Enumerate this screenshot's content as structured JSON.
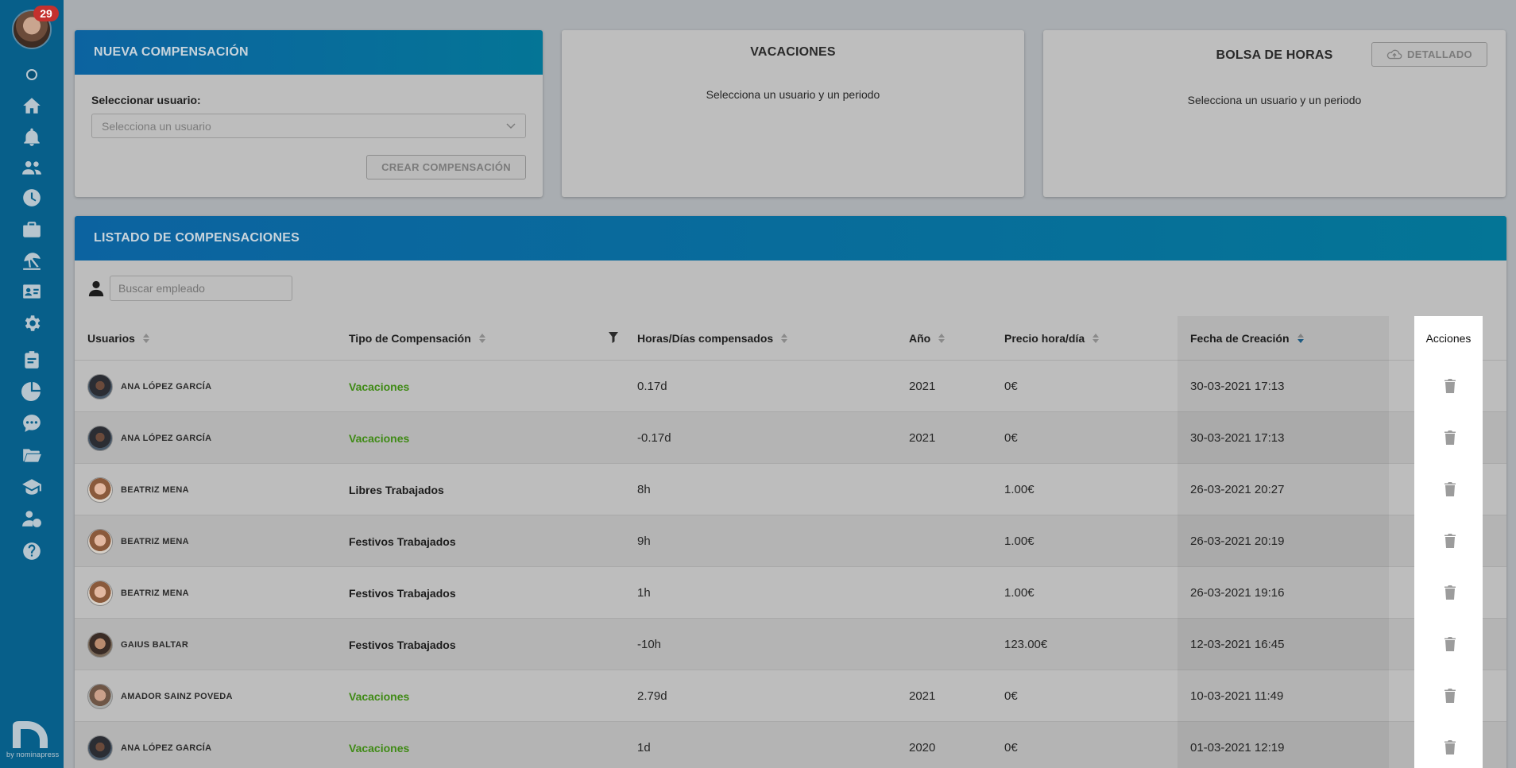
{
  "sidebar": {
    "notification_count": "29",
    "brand_caption": "by nominapress",
    "icons": [
      "home-icon",
      "bell-icon",
      "users-icon",
      "clock-icon",
      "briefcase-icon",
      "beach-icon",
      "id-card-icon",
      "gear-icon",
      "clipboard-icon",
      "pie-chart-icon",
      "chat-icon",
      "folder-icon",
      "graduation-icon",
      "user-money-icon",
      "help-icon"
    ]
  },
  "nueva": {
    "header": "NUEVA COMPENSACIÓN",
    "select_label": "Seleccionar usuario:",
    "select_placeholder": "Selecciona un usuario",
    "create_button": "CREAR COMPENSACIÓN"
  },
  "vacaciones": {
    "title": "VACACIONES",
    "message": "Selecciona un usuario y un periodo"
  },
  "bolsa": {
    "title": "BOLSA DE HORAS",
    "detail_button": "DETALLADO",
    "message": "Selecciona un usuario y un periodo"
  },
  "listado": {
    "header": "LISTADO DE COMPENSACIONES",
    "search_placeholder": "Buscar empleado",
    "columns": {
      "usuarios": "Usuarios",
      "tipo": "Tipo de Compensación",
      "horas": "Horas/Días compensados",
      "anio": "Año",
      "precio": "Precio hora/día",
      "fecha": "Fecha de Creación",
      "acciones": "Acciones"
    },
    "rows": [
      {
        "user": "ANA LÓPEZ GARCÍA",
        "tipo": "Vacaciones",
        "horas": "0.17d",
        "anio": "2021",
        "precio": "0€",
        "fecha": "30-03-2021 17:13"
      },
      {
        "user": "ANA LÓPEZ GARCÍA",
        "tipo": "Vacaciones",
        "horas": "-0.17d",
        "anio": "2021",
        "precio": "0€",
        "fecha": "30-03-2021 17:13"
      },
      {
        "user": "BEATRIZ MENA",
        "tipo": "Libres Trabajados",
        "horas": "8h",
        "anio": "",
        "precio": "1.00€",
        "fecha": "26-03-2021 20:27"
      },
      {
        "user": "BEATRIZ MENA",
        "tipo": "Festivos Trabajados",
        "horas": "9h",
        "anio": "",
        "precio": "1.00€",
        "fecha": "26-03-2021 20:19"
      },
      {
        "user": "BEATRIZ MENA",
        "tipo": "Festivos Trabajados",
        "horas": "1h",
        "anio": "",
        "precio": "1.00€",
        "fecha": "26-03-2021 19:16"
      },
      {
        "user": "GAIUS BALTAR",
        "tipo": "Festivos Trabajados",
        "horas": "-10h",
        "anio": "",
        "precio": "123.00€",
        "fecha": "12-03-2021 16:45"
      },
      {
        "user": "AMADOR SAINZ POVEDA",
        "tipo": "Vacaciones",
        "horas": "2.79d",
        "anio": "2021",
        "precio": "0€",
        "fecha": "10-03-2021 11:49"
      },
      {
        "user": "ANA LÓPEZ GARCÍA",
        "tipo": "Vacaciones",
        "horas": "1d",
        "anio": "2020",
        "precio": "0€",
        "fecha": "01-03-2021 12:19"
      }
    ]
  },
  "colors": {
    "sidebar": "#075f8a",
    "header_gradient_start": "#0c63a0",
    "vacaciones_green": "#3f8a15",
    "badge_red": "#c4312e"
  }
}
